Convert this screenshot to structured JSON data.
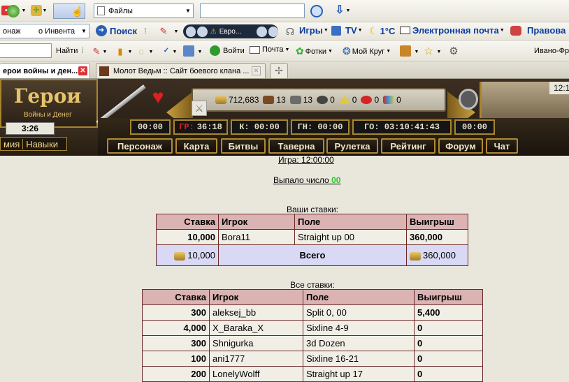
{
  "toolbar1": {
    "combo_label": "Файлы",
    "search_value": ""
  },
  "toolbar2": {
    "left_combo": "онаж",
    "combo2": "о Инвента",
    "search_label": "Поиск",
    "media_text": "Евро...",
    "games_label": "Игры",
    "tv_label": "TV",
    "weather": "1°C",
    "mail_label": "Электронная почта",
    "law_label": "Правова"
  },
  "toolbar3": {
    "find_label": "Найти",
    "login_label": "Войти",
    "mail_label": "Почта",
    "photos_label": "Фотки",
    "mycircle_label": "Мой Круг",
    "region": "Ивано-Фр"
  },
  "tabs": [
    {
      "title": "ерои войны и ден..."
    },
    {
      "title": "Молот Ведьм :: Сайт боевого клана ..."
    }
  ],
  "game": {
    "logo_title": "Герои",
    "logo_sub": "Войны и Денег",
    "clock": "12:1",
    "level_timer": "3:26",
    "resources": {
      "gold": "712,683",
      "wood": "13",
      "ore": "13",
      "r3": "0",
      "r4": "0",
      "r5": "0",
      "r6": "0"
    },
    "timers": [
      "00:00",
      "36:18",
      "К: 00:00",
      "ГН: 00:00",
      "ГО: 03:10:41:43",
      "00:00"
    ],
    "gr_label": "ГР:",
    "left_links": [
      "мия",
      "Навыки"
    ],
    "nav": [
      "Персонаж",
      "Карта",
      "Битвы",
      "Таверна",
      "Рулетка",
      "Рейтинг",
      "Форум",
      "Чат"
    ]
  },
  "roulette": {
    "game_time": "Игра: 12:00:00",
    "result_label": "Выпало число",
    "result_number": "00",
    "your_bets_caption": "Ваши ставки:",
    "all_bets_caption": "Все ставки:",
    "headers": {
      "bet": "Ставка",
      "player": "Игрок",
      "field": "Поле",
      "win": "Выигрыш"
    },
    "your_bets": [
      {
        "bet": "10,000",
        "player": "Bora11",
        "field": "Straight up 00",
        "win": "360,000"
      }
    ],
    "total": {
      "bet": "10,000",
      "label": "Всего",
      "win": "360,000"
    },
    "all_bets": [
      {
        "bet": "300",
        "player": "aleksej_bb",
        "field": "Split 0, 00",
        "win": "5,400"
      },
      {
        "bet": "4,000",
        "player": "X_Baraka_X",
        "field": "Sixline 4-9",
        "win": "0"
      },
      {
        "bet": "300",
        "player": "Shnigurka",
        "field": "3d Dozen",
        "win": "0"
      },
      {
        "bet": "100",
        "player": "ani1777",
        "field": "Sixline 16-21",
        "win": "0"
      },
      {
        "bet": "200",
        "player": "LonelyWolff",
        "field": "Straight up 17",
        "win": "0"
      }
    ]
  },
  "colors": {
    "accent_green": "#22cc22",
    "table_header": "#dbb3b3",
    "table_border": "#6b2a2a"
  }
}
